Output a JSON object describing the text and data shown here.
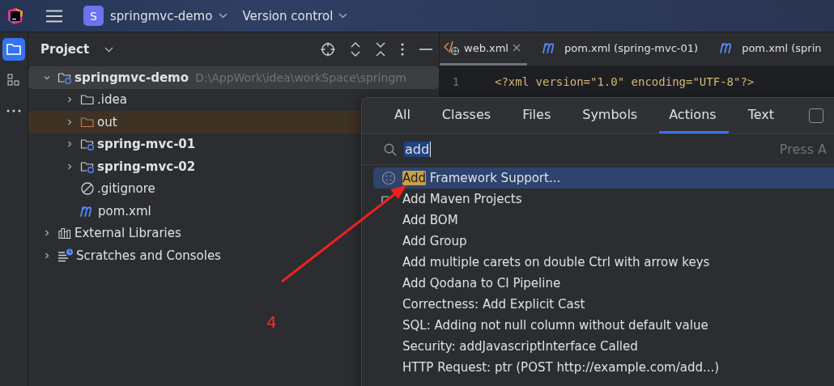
{
  "title_bar": {
    "project_letter": "S",
    "project": "springmvc-demo",
    "vcs": "Version control"
  },
  "sidebar": {
    "items": [
      {
        "kind": "project",
        "selected": true
      },
      {
        "kind": "structure",
        "selected": false
      },
      {
        "kind": "more",
        "selected": false
      }
    ]
  },
  "project_panel": {
    "title": "Project",
    "tree": [
      {
        "name": "springmvc-demo",
        "path": "D:\\AppWork\\idea\\workSpace\\springm",
        "kind": "module",
        "bold": true,
        "expanded": true,
        "selected": true,
        "excluded": false,
        "children": [
          {
            "name": ".idea",
            "kind": "folder",
            "bold": false,
            "expanded": false,
            "selected": false,
            "excluded": false
          },
          {
            "name": "out",
            "kind": "folder",
            "bold": false,
            "expanded": false,
            "selected": false,
            "excluded": true
          },
          {
            "name": "spring-mvc-01",
            "kind": "module",
            "bold": true,
            "expanded": false,
            "selected": false,
            "excluded": false
          },
          {
            "name": "spring-mvc-02",
            "kind": "module",
            "bold": true,
            "expanded": false,
            "selected": false,
            "excluded": false
          },
          {
            "name": ".gitignore",
            "kind": "ignore",
            "bold": false,
            "selected": false,
            "excluded": false
          },
          {
            "name": "pom.xml",
            "kind": "maven",
            "bold": false,
            "selected": false,
            "excluded": false
          }
        ]
      },
      {
        "name": "External Libraries",
        "kind": "libraries",
        "bold": false,
        "expanded": false,
        "selected": false,
        "excluded": false
      },
      {
        "name": "Scratches and Consoles",
        "kind": "scratches",
        "bold": false,
        "expanded": false,
        "selected": false,
        "excluded": false
      }
    ]
  },
  "editor": {
    "tabs": [
      {
        "label": "web.xml",
        "kind": "xml",
        "selected": true
      },
      {
        "label": "pom.xml (spring-mvc-01)",
        "kind": "maven",
        "selected": false
      },
      {
        "label": "pom.xml (sprin",
        "kind": "maven",
        "selected": false
      }
    ],
    "lines": [
      {
        "number": "1",
        "code": "<?xml version=\"1.0\" encoding=\"UTF-8\"?>"
      }
    ]
  },
  "search_popup": {
    "tabs": [
      {
        "label": "All",
        "selected": false
      },
      {
        "label": "Classes",
        "selected": false
      },
      {
        "label": "Files",
        "selected": false
      },
      {
        "label": "Symbols",
        "selected": false
      },
      {
        "label": "Actions",
        "selected": true
      },
      {
        "label": "Text",
        "selected": false
      }
    ],
    "option_checked": false,
    "query": "add",
    "hint": "Press A",
    "results": [
      {
        "match": "Add",
        "label": " Framework Support...",
        "kind": "framework",
        "selected": true
      },
      {
        "label": "Add Maven Projects",
        "kind": "maven",
        "selected": false
      },
      {
        "label": "Add BOM",
        "kind": "plain",
        "selected": false
      },
      {
        "label": "Add Group",
        "kind": "plain",
        "selected": false
      },
      {
        "label": "Add multiple carets on double Ctrl with arrow keys",
        "kind": "plain",
        "selected": false
      },
      {
        "label": "Add Qodana to CI Pipeline",
        "kind": "plain",
        "selected": false
      },
      {
        "label": "Correctness: Add Explicit Cast",
        "kind": "plain",
        "selected": false
      },
      {
        "label": "SQL: Adding not null column without default value",
        "kind": "plain",
        "selected": false
      },
      {
        "label": "Security: addJavascriptInterface Called",
        "kind": "plain",
        "selected": false
      },
      {
        "label": "HTTP Request: ptr (POST http://example.com/add...)",
        "kind": "plain",
        "selected": false
      }
    ]
  },
  "annotation": {
    "label": "4"
  }
}
